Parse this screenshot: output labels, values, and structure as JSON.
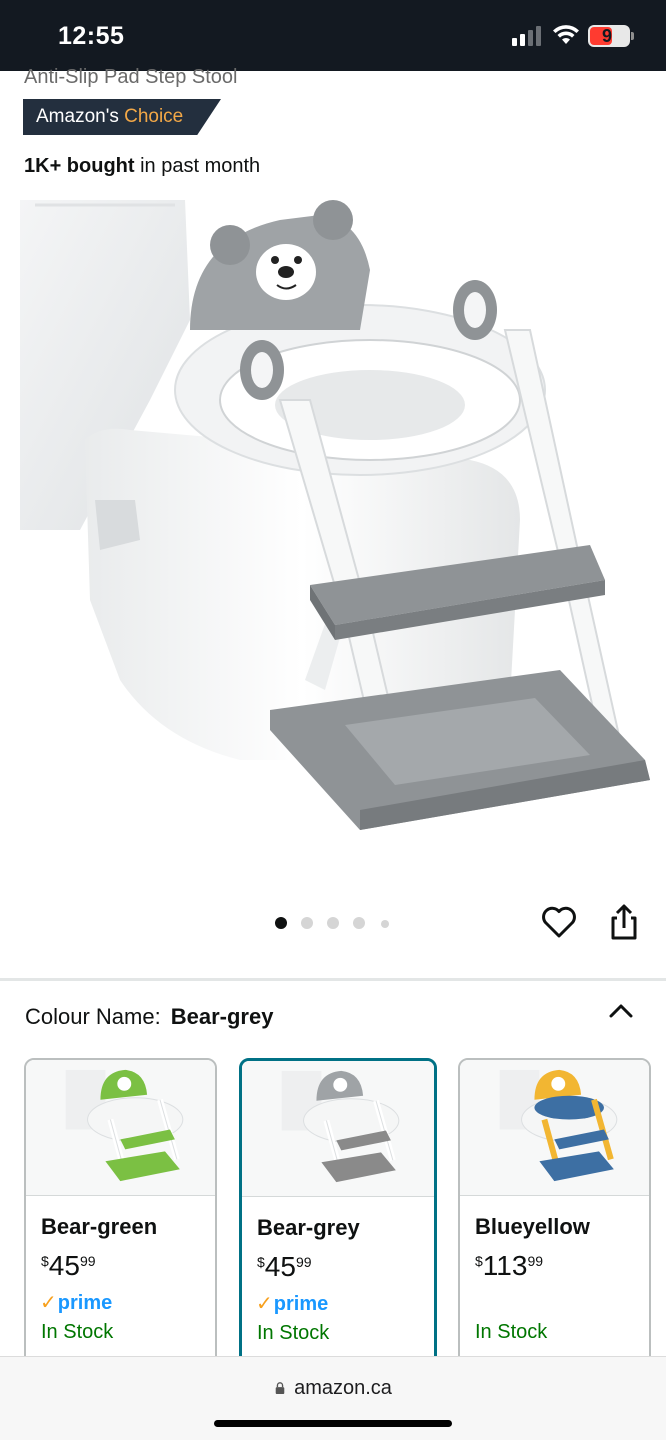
{
  "status_bar": {
    "time": "12:55",
    "battery": "9",
    "colors": {
      "background": "#131921",
      "battery_low": "#ff3b30"
    }
  },
  "product": {
    "subtitle": "Anti-Slip Pad Step Stool",
    "badge": {
      "prefix": "Amazon's",
      "accent": "Choice",
      "accent_color": "#f3a847"
    },
    "bought": {
      "bold": "1K+ bought",
      "rest": "in past month"
    },
    "image_alt_icon": "potty-training-seat-image"
  },
  "carousel": {
    "total_dots": 5,
    "active_index": 0,
    "icons": {
      "favorite": "heart-icon",
      "share": "share-icon"
    }
  },
  "colour_selector": {
    "label": "Colour Name:",
    "value": "Bear-grey",
    "toggle_icon": "chevron-up-icon",
    "options": [
      {
        "name": "Bear-green",
        "currency": "$",
        "whole": "45",
        "fraction": "99",
        "prime": true,
        "stock": "In Stock",
        "accent": "#7bc043",
        "selected": false
      },
      {
        "name": "Bear-grey",
        "currency": "$",
        "whole": "45",
        "fraction": "99",
        "prime": true,
        "stock": "In Stock",
        "accent": "#8a8a8a",
        "selected": true
      },
      {
        "name": "Blueyellow",
        "currency": "$",
        "whole": "113",
        "fraction": "99",
        "prime": false,
        "stock": "In Stock",
        "accent": "#3d6fa3",
        "selected": false
      }
    ],
    "prime_label": "prime",
    "prime_check": "✓"
  },
  "browser": {
    "url": "amazon.ca"
  },
  "colors": {
    "selected_border": "#007185",
    "in_stock": "#007600",
    "prime_blue": "#1a98ff"
  }
}
